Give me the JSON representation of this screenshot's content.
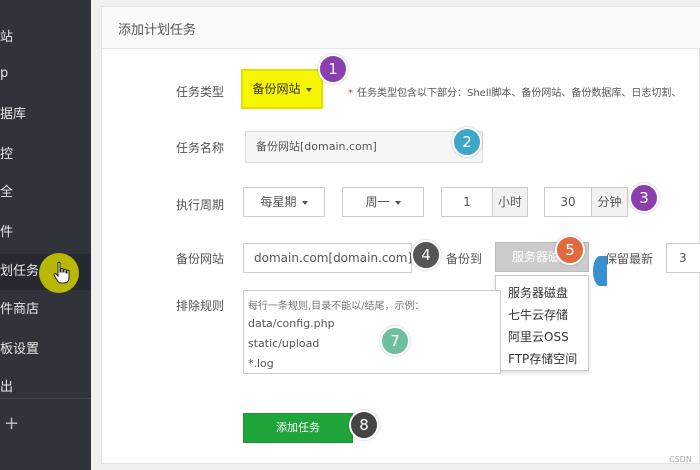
{
  "sidebar": {
    "items": [
      {
        "label": "站"
      },
      {
        "label": "p"
      },
      {
        "label": "据库"
      },
      {
        "label": "控"
      },
      {
        "label": "全"
      },
      {
        "label": "件"
      },
      {
        "label": "划任务"
      },
      {
        "label": "件商店"
      },
      {
        "label": "板设置"
      },
      {
        "label": "出"
      }
    ],
    "plus": "+"
  },
  "panel": {
    "title": "添加计划任务"
  },
  "form": {
    "task_type_label": "任务类型",
    "task_type_value": "备份网站",
    "hint_star": "*",
    "hint_text": "任务类型包含以下部分：Shell脚本、备份网站、备份数据库、日志切割、",
    "task_name_label": "任务名称",
    "task_name_value": "备份网站[domain.com]",
    "period_label": "执行周期",
    "period_select": "每星期",
    "weekday_select": "周一",
    "hour_value": "1",
    "hour_unit": "小时",
    "minute_value": "30",
    "minute_unit": "分钟",
    "site_label": "备份网站",
    "site_value": "domain.com[domain.com]",
    "backup_to_label": "备份到",
    "storage_selected": "服务器磁盘",
    "storage_options": [
      "服务器磁盘",
      "七牛云存储",
      "阿里云OSS",
      "FTP存储空间"
    ],
    "keep_label": "保留最新",
    "keep_value": "3",
    "exclude_label": "排除规则",
    "exclude_placeholder": "每行一条规则,目录不能以/结尾，示例：",
    "exclude_lines": [
      "data/config.php",
      "static/upload",
      " *.log"
    ],
    "submit_label": "添加任务"
  },
  "badges": [
    "1",
    "2",
    "3",
    "4",
    "5",
    "7",
    "8"
  ],
  "watermark": "CSDN",
  "colors": {
    "sidebar_bg": "#30343a",
    "highlight_yellow": "#f6f600",
    "submit_green": "#20a53a",
    "badge_purple": "#8a3fae",
    "badge_teal": "#3ea6c6",
    "badge_orange": "#e06b3f"
  }
}
